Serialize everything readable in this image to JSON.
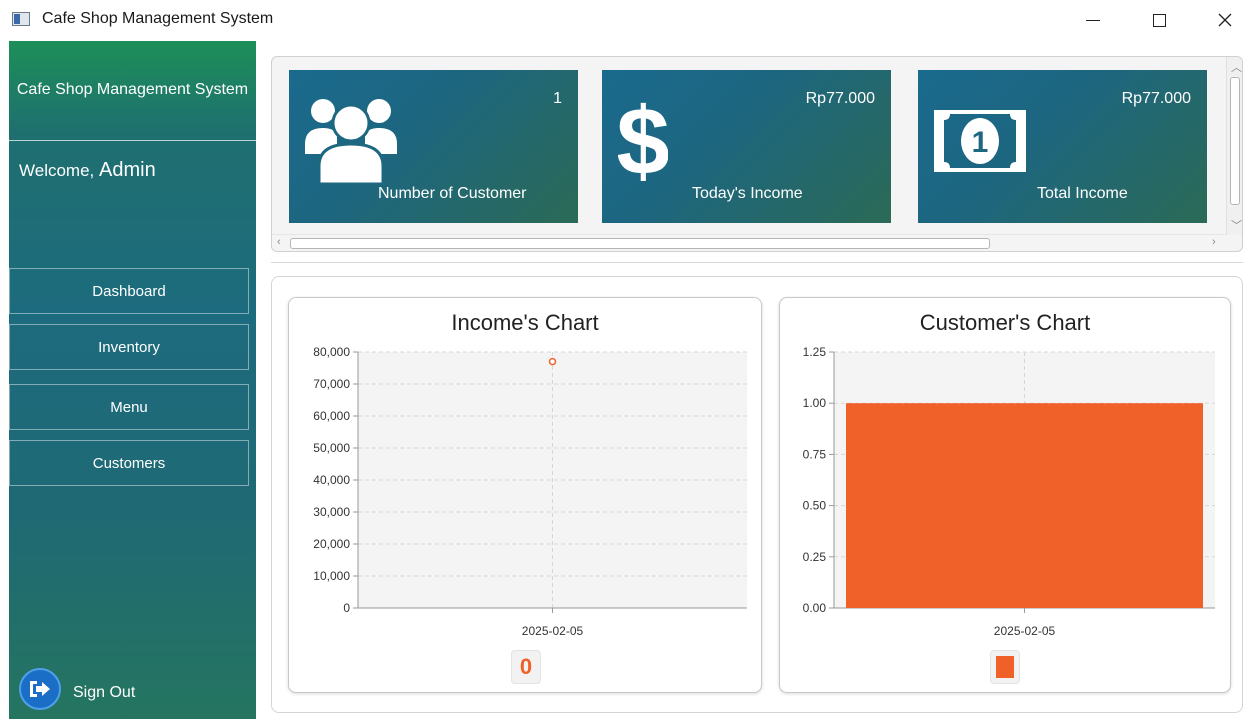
{
  "window": {
    "title": "Cafe Shop Management System"
  },
  "sidebar": {
    "title": "Cafe Shop Management System",
    "welcome_prefix": "Welcome,",
    "username": "Admin",
    "nav": [
      {
        "label": "Dashboard"
      },
      {
        "label": "Inventory"
      },
      {
        "label": "Menu"
      },
      {
        "label": "Customers"
      }
    ],
    "signout_label": "Sign Out"
  },
  "cards": [
    {
      "value": "1",
      "label": "Number of Customer",
      "icon": "users-icon"
    },
    {
      "value": "Rp77.000",
      "label": "Today's Income",
      "icon": "dollar-icon"
    },
    {
      "value": "Rp77.000",
      "label": "Total Income",
      "icon": "banknote-icon"
    }
  ],
  "colors": {
    "accent_orange": "#f0612a",
    "sidebar_top": "#1d8f58",
    "sidebar_mid": "#1d6b7e",
    "card_blue": "#1a6a8e"
  },
  "chart_data": [
    {
      "type": "line",
      "title": "Income's Chart",
      "x": [
        "2025-02-05"
      ],
      "series": [
        {
          "values": [
            77000
          ]
        }
      ],
      "ylim": [
        0,
        80000
      ],
      "yticks": [
        "0",
        "10,000",
        "20,000",
        "30,000",
        "40,000",
        "50,000",
        "60,000",
        "70,000",
        "80,000"
      ],
      "grid": true,
      "legend_marker": "0"
    },
    {
      "type": "bar",
      "title": "Customer's Chart",
      "categories": [
        "2025-02-05"
      ],
      "series": [
        {
          "values": [
            1
          ]
        }
      ],
      "ylim": [
        0,
        1.25
      ],
      "yticks": [
        "0.00",
        "0.25",
        "0.50",
        "0.75",
        "1.00",
        "1.25"
      ],
      "grid": true
    }
  ]
}
